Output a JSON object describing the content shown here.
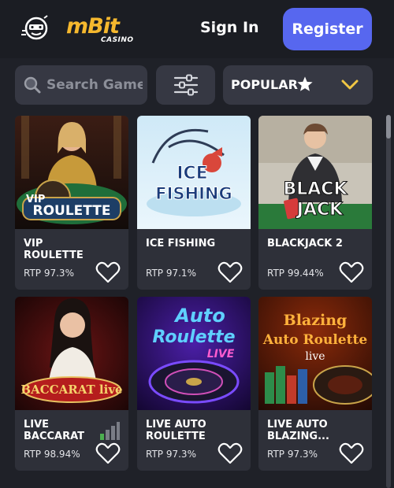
{
  "header": {
    "logo_main": "m",
    "logo_accent": "Bit",
    "logo_sub": "CASINO",
    "signin_label": "Sign In",
    "register_label": "Register"
  },
  "toolbar": {
    "search_placeholder": "Search Games",
    "search_value": "",
    "sort_selected": "POPULAR"
  },
  "colors": {
    "background": "#1f2128",
    "card": "#2e3039",
    "control": "#363843",
    "register": "#5767ef",
    "logo": "#f5b82e",
    "chevron": "#f1c744"
  },
  "games": [
    {
      "title": "VIP ROULETTE",
      "rtp": "RTP 97.3%",
      "thumb_text": "VIP ROULETTE"
    },
    {
      "title": "ICE FISHING",
      "rtp": "RTP 97.1%",
      "thumb_text": "ICE FISHING"
    },
    {
      "title": "BLACKJACK 2",
      "rtp": "RTP 99.44%",
      "thumb_text": "BLACK JACK"
    },
    {
      "title": "LIVE BACCARAT",
      "rtp": "RTP 98.94%",
      "thumb_text": "BACCARAT live"
    },
    {
      "title": "LIVE AUTO ROULETTE",
      "rtp": "RTP 97.3%",
      "thumb_text": "Auto Roulette LIVE"
    },
    {
      "title": "LIVE AUTO BLAZING...",
      "rtp": "RTP 97.3%",
      "thumb_text": "Blazing Auto Roulette live"
    }
  ],
  "thumb_texts": {
    "vip": "VIP",
    "roulette": "ROULETTE",
    "ice": "ICE",
    "fishing": "FISHING",
    "black": "BLACK",
    "jack": "JACK",
    "baccarat": "BACCARAT live",
    "auto": "Auto",
    "roulette2": "Roulette",
    "live2": "LIVE",
    "blazing": "Blazing",
    "autoroulette": "Auto Roulette",
    "live3": "live"
  },
  "icons": {
    "search": "search-icon",
    "filter": "sliders-icon",
    "sort": "star-icon",
    "dropdown": "chevron-down-icon",
    "favorite": "heart-icon",
    "signal": "signal-bars-icon"
  }
}
